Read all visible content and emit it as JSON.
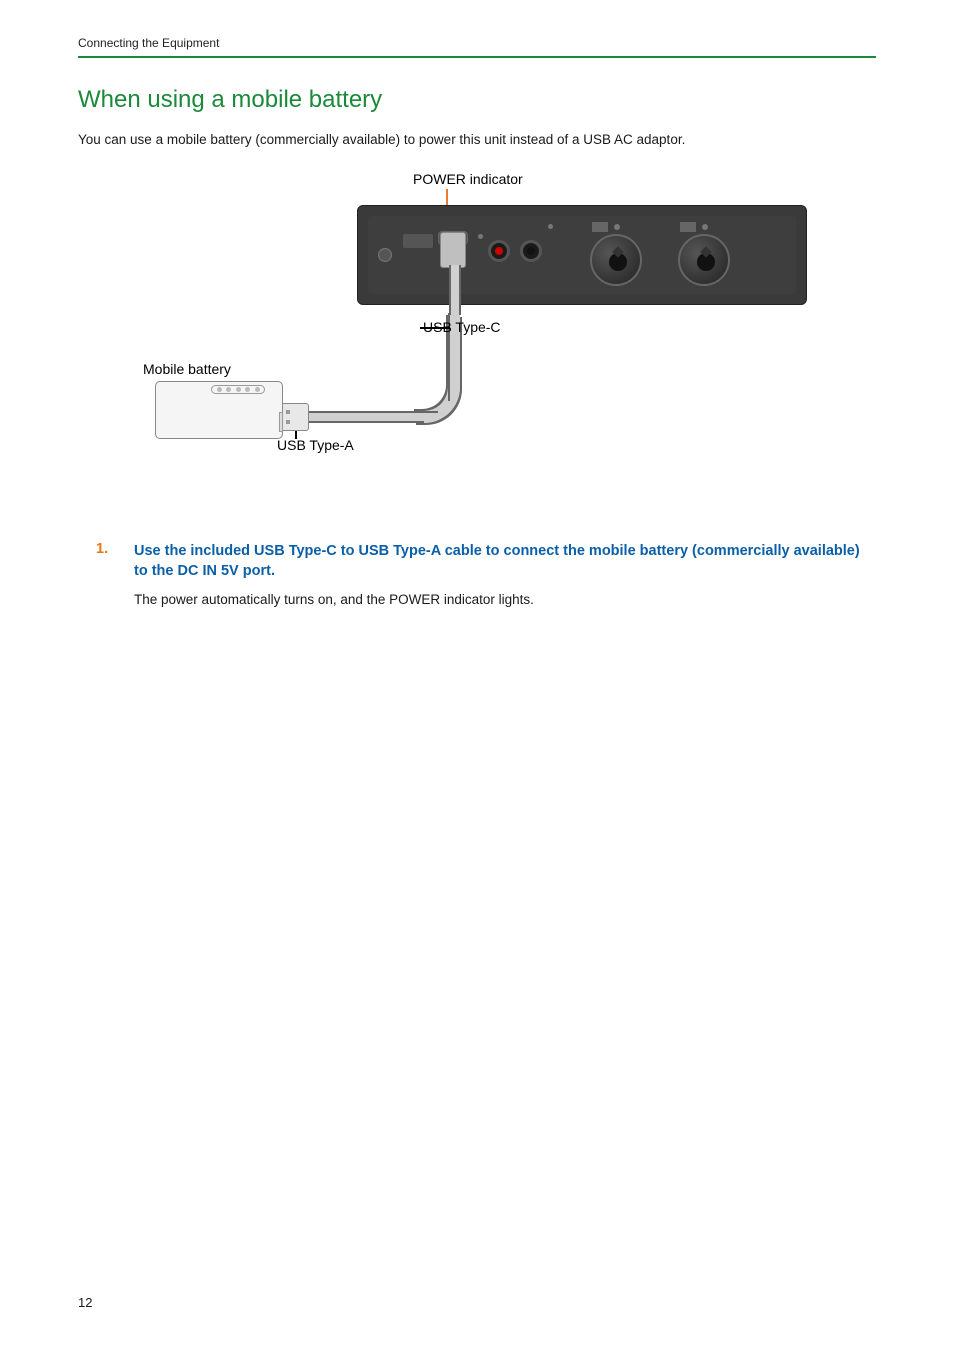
{
  "header": {
    "running_title": "Connecting the Equipment"
  },
  "section": {
    "title": "When using a mobile battery",
    "intro": "You can use a mobile battery (commercially available) to power this unit instead of a USB AC adaptor."
  },
  "figure": {
    "power_indicator_label": "POWER indicator",
    "usb_c_label": "USB Type-C",
    "usb_a_label": "USB Type-A",
    "mobile_battery_label": "Mobile battery"
  },
  "steps": [
    {
      "number": "1.",
      "title": "Use the included USB Type-C to USB Type-A cable to connect the mobile battery (commercially available) to the DC IN 5V port.",
      "body": "The power automatically turns on, and the POWER indicator lights."
    }
  ],
  "page_number": "12"
}
